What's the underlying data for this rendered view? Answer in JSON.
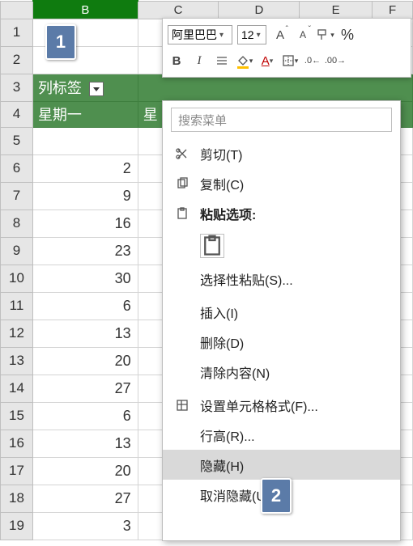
{
  "columns": [
    "B",
    "C",
    "D",
    "E",
    "F"
  ],
  "selected_column_index": 0,
  "rows": [
    {
      "num": 1,
      "cells": [
        "",
        "",
        "",
        "",
        ""
      ]
    },
    {
      "num": 2,
      "cells": [
        "",
        "",
        "",
        "",
        ""
      ]
    },
    {
      "num": 3,
      "pivot_label": "列标签"
    },
    {
      "num": 4,
      "header": [
        "星期一",
        "星"
      ]
    },
    {
      "num": 5,
      "cells": [
        "",
        "",
        "",
        "",
        ""
      ]
    },
    {
      "num": 6,
      "cells": [
        "2",
        "",
        "",
        "",
        ""
      ]
    },
    {
      "num": 7,
      "cells": [
        "9",
        "",
        "",
        "",
        ""
      ]
    },
    {
      "num": 8,
      "cells": [
        "16",
        "",
        "",
        "",
        ""
      ]
    },
    {
      "num": 9,
      "cells": [
        "23",
        "",
        "",
        "",
        ""
      ]
    },
    {
      "num": 10,
      "cells": [
        "30",
        "",
        "",
        "",
        ""
      ]
    },
    {
      "num": 11,
      "cells": [
        "6",
        "",
        "",
        "",
        ""
      ]
    },
    {
      "num": 12,
      "cells": [
        "13",
        "",
        "",
        "",
        ""
      ]
    },
    {
      "num": 13,
      "cells": [
        "20",
        "",
        "",
        "",
        ""
      ]
    },
    {
      "num": 14,
      "cells": [
        "27",
        "",
        "",
        "",
        ""
      ]
    },
    {
      "num": 15,
      "cells": [
        "6",
        "",
        "",
        "",
        ""
      ]
    },
    {
      "num": 16,
      "cells": [
        "13",
        "",
        "",
        "",
        ""
      ]
    },
    {
      "num": 17,
      "cells": [
        "20",
        "",
        "",
        "",
        ""
      ]
    },
    {
      "num": 18,
      "cells": [
        "27",
        "",
        "",
        "",
        ""
      ]
    },
    {
      "num": 19,
      "cells": [
        "3",
        "",
        "",
        "",
        ""
      ]
    }
  ],
  "toolbar": {
    "font_name": "阿里巴巴",
    "font_size": "12",
    "percent": "%"
  },
  "menu": {
    "search_placeholder": "搜索菜单",
    "cut": "剪切(T)",
    "copy": "复制(C)",
    "paste_options": "粘贴选项:",
    "paste_special": "选择性粘贴(S)...",
    "insert": "插入(I)",
    "delete": "删除(D)",
    "clear": "清除内容(N)",
    "format_cells": "设置单元格格式(F)...",
    "row_height": "行高(R)...",
    "hide": "隐藏(H)",
    "unhide": "取消隐藏(U)"
  },
  "callouts": {
    "one": "1",
    "two": "2"
  }
}
